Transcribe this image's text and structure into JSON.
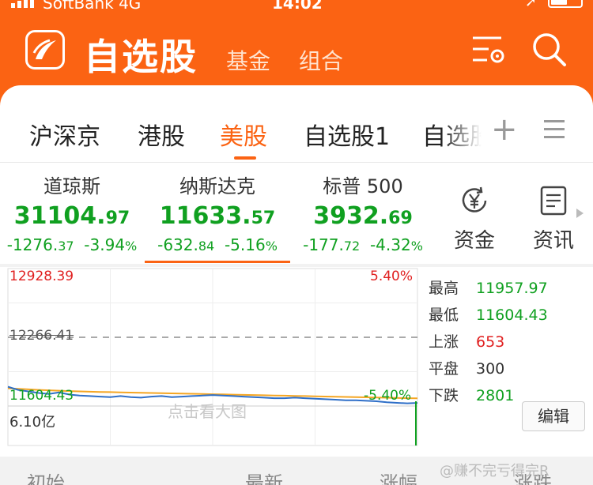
{
  "status_bar": {
    "carrier": "SoftBank",
    "network": "4G",
    "time": "14:02"
  },
  "header": {
    "title": "自选股",
    "tabs": [
      "基金",
      "组合"
    ],
    "icons": [
      "settings-list-icon",
      "search-icon"
    ]
  },
  "market_tabs": [
    {
      "label": "沪深京",
      "active": false
    },
    {
      "label": "港股",
      "active": false
    },
    {
      "label": "美股",
      "active": true
    },
    {
      "label": "自选股1",
      "active": false
    },
    {
      "label": "自选股",
      "active": false
    }
  ],
  "indices": [
    {
      "name": "道琼斯",
      "value_int": "31104.",
      "value_dec": "97",
      "chg_int": "-1276.",
      "chg_dec": "37",
      "pct_int": "-3.94",
      "pct_unit": "%"
    },
    {
      "name": "纳斯达克",
      "value_int": "11633.",
      "value_dec": "57",
      "chg_int": "-632.",
      "chg_dec": "84",
      "pct_int": "-5.16",
      "pct_unit": "%"
    },
    {
      "name": "标普 500",
      "value_int": "3932.",
      "value_dec": "69",
      "chg_int": "-177.",
      "chg_dec": "72",
      "pct_int": "-4.32",
      "pct_unit": "%"
    }
  ],
  "side_buttons": [
    {
      "label": "资金",
      "icon": "yen-fund-icon"
    },
    {
      "label": "资讯",
      "icon": "news-document-icon"
    }
  ],
  "chart": {
    "max_label": "12928.39",
    "max_pct": "5.40%",
    "mid_label": "12266.41",
    "min_label": "11604.43",
    "min_pct": "-5.40%",
    "volume_label": "6.10亿",
    "watermark": "点击看大图",
    "colors": {
      "up": "#e02020",
      "down": "#10a020",
      "price_line": "#2f6fc8",
      "avg_line": "#f5a623"
    }
  },
  "chart_data": {
    "type": "line",
    "title": "",
    "ylim": [
      11604.43,
      12928.39
    ],
    "y_ref": 12266.41,
    "x": [
      0,
      1,
      2,
      3,
      4,
      5,
      6,
      7,
      8,
      9,
      10,
      11,
      12,
      13,
      14,
      15,
      16,
      17,
      18,
      19,
      20,
      21,
      22,
      23,
      24,
      25,
      26,
      27,
      28,
      29,
      30,
      31,
      32,
      33,
      34,
      35,
      36,
      37,
      38,
      39,
      40
    ],
    "series": [
      {
        "values": [
          11790,
          11760,
          11745,
          11730,
          11720,
          11735,
          11715,
          11705,
          11700,
          11695,
          11690,
          11700,
          11690,
          11685,
          11695,
          11700,
          11690,
          11695,
          11700,
          11705,
          11710,
          11705,
          11700,
          11695,
          11690,
          11685,
          11680,
          11680,
          11685,
          11680,
          11675,
          11670,
          11665,
          11660,
          11660,
          11655,
          11650,
          11640,
          11635,
          11630,
          11634
        ]
      },
      {
        "values": [
          11775,
          11770,
          11765,
          11760,
          11756,
          11752,
          11748,
          11745,
          11742,
          11740,
          11738,
          11736,
          11734,
          11732,
          11730,
          11728,
          11726,
          11724,
          11722,
          11720,
          11718,
          11716,
          11714,
          11712,
          11710,
          11708,
          11706,
          11704,
          11702,
          11700,
          11698,
          11696,
          11694,
          11692,
          11690,
          11688,
          11686,
          11684,
          11682,
          11680,
          11678
        ]
      }
    ]
  },
  "stats": [
    {
      "label": "最高",
      "value": "11957.97",
      "color": "#10a020"
    },
    {
      "label": "最低",
      "value": "11604.43",
      "color": "#10a020"
    },
    {
      "label": "上涨",
      "value": "653",
      "color": "#e02020"
    },
    {
      "label": "平盘",
      "value": "300",
      "color": "#333333"
    },
    {
      "label": "下跌",
      "value": "2801",
      "color": "#10a020"
    }
  ],
  "edit_button": "编辑",
  "bottom_columns": [
    "初始",
    "最新",
    "涨幅",
    "涨跌"
  ],
  "watermark": "@赚不完亏得完R"
}
